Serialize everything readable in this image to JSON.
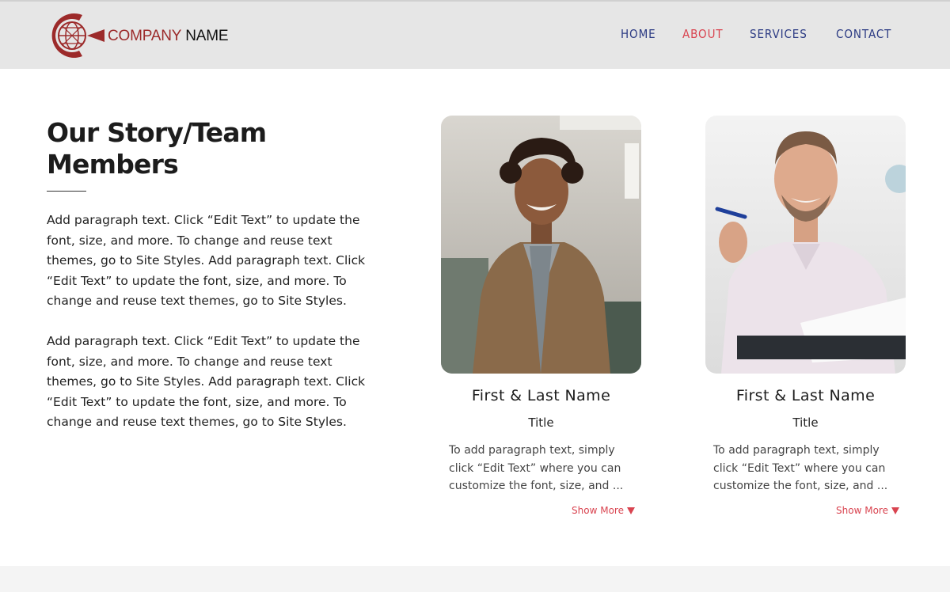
{
  "brand": {
    "company": "COMPANY",
    "name": "NAME",
    "logo_color": "#9c2a2a"
  },
  "nav": {
    "items": [
      {
        "label": "HOME",
        "active": false
      },
      {
        "label": "ABOUT",
        "active": true
      },
      {
        "label": "SERVICES",
        "active": false
      },
      {
        "label": "CONTACT",
        "active": false
      }
    ],
    "color": "#2b3a83",
    "active_color": "#d94450"
  },
  "story": {
    "heading": "Our Story/Team Members",
    "paragraphs": [
      "Add paragraph text. Click “Edit Text” to update the font, size, and more. To change and reuse text themes, go to Site Styles. Add paragraph text. Click “Edit Text” to update the font, size, and more. To change and reuse text themes, go to Site Styles.",
      "Add paragraph text. Click “Edit Text” to update the font, size, and more. To change and reuse text themes, go to Site Styles. Add paragraph text. Click “Edit Text” to update the font, size, and more. To change and reuse text themes, go to Site Styles."
    ]
  },
  "team": [
    {
      "photo_icon": "woman-portrait",
      "name": "First & Last Name",
      "title": "Title",
      "description": "To add paragraph text, simply click “Edit Text” where you can customize the font, size, and ...",
      "show_more": "Show More"
    },
    {
      "photo_icon": "man-portrait",
      "name": "First & Last Name",
      "title": "Title",
      "description": "To add paragraph text, simply click “Edit Text” where you can customize the font, size, and ...",
      "show_more": "Show More"
    }
  ]
}
